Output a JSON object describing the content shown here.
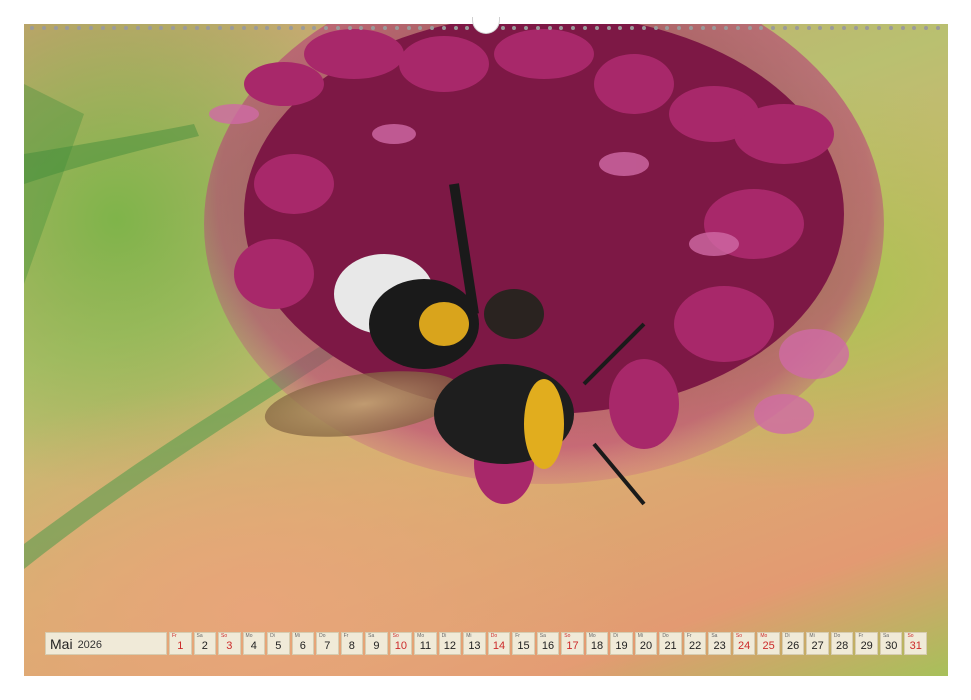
{
  "calendar": {
    "month": "Mai",
    "year": "2026",
    "days": [
      {
        "dow": "Fr",
        "num": "1",
        "red": true
      },
      {
        "dow": "Sa",
        "num": "2",
        "red": false
      },
      {
        "dow": "So",
        "num": "3",
        "red": true
      },
      {
        "dow": "Mo",
        "num": "4",
        "red": false
      },
      {
        "dow": "Di",
        "num": "5",
        "red": false
      },
      {
        "dow": "Mi",
        "num": "6",
        "red": false
      },
      {
        "dow": "Do",
        "num": "7",
        "red": false
      },
      {
        "dow": "Fr",
        "num": "8",
        "red": false
      },
      {
        "dow": "Sa",
        "num": "9",
        "red": false
      },
      {
        "dow": "So",
        "num": "10",
        "red": true
      },
      {
        "dow": "Mo",
        "num": "11",
        "red": false
      },
      {
        "dow": "Di",
        "num": "12",
        "red": false
      },
      {
        "dow": "Mi",
        "num": "13",
        "red": false
      },
      {
        "dow": "Do",
        "num": "14",
        "red": true
      },
      {
        "dow": "Fr",
        "num": "15",
        "red": false
      },
      {
        "dow": "Sa",
        "num": "16",
        "red": false
      },
      {
        "dow": "So",
        "num": "17",
        "red": true
      },
      {
        "dow": "Mo",
        "num": "18",
        "red": false
      },
      {
        "dow": "Di",
        "num": "19",
        "red": false
      },
      {
        "dow": "Mi",
        "num": "20",
        "red": false
      },
      {
        "dow": "Do",
        "num": "21",
        "red": false
      },
      {
        "dow": "Fr",
        "num": "22",
        "red": false
      },
      {
        "dow": "Sa",
        "num": "23",
        "red": false
      },
      {
        "dow": "So",
        "num": "24",
        "red": true
      },
      {
        "dow": "Mo",
        "num": "25",
        "red": true
      },
      {
        "dow": "Di",
        "num": "26",
        "red": false
      },
      {
        "dow": "Mi",
        "num": "27",
        "red": false
      },
      {
        "dow": "Do",
        "num": "28",
        "red": false
      },
      {
        "dow": "Fr",
        "num": "29",
        "red": false
      },
      {
        "dow": "Sa",
        "num": "30",
        "red": false
      },
      {
        "dow": "So",
        "num": "31",
        "red": true
      }
    ]
  },
  "photo": {
    "subject_icon": "bumblebee-on-allium-flower-image"
  },
  "colors": {
    "holiday_red": "#cc2a2a",
    "strip_bg": "#f0ead8",
    "flower_magenta": "#9a1f5a",
    "background_green": "#a8c451"
  }
}
